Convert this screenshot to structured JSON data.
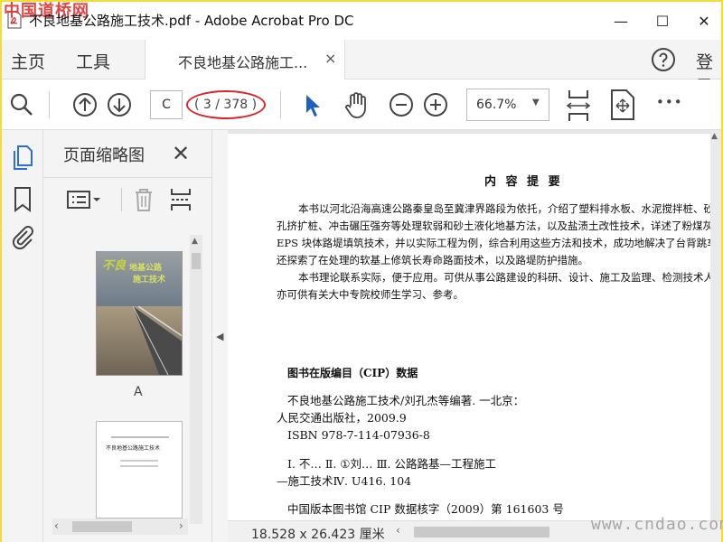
{
  "window": {
    "title": "不良地基公路施工技术.pdf - Adobe Acrobat Pro DC",
    "watermark_top": "中国道桥网",
    "minimize": "—",
    "maximize": "☐",
    "close": "✕"
  },
  "tabs": {
    "home": "主页",
    "tools": "工具",
    "document": "不良地基公路施工...",
    "close": "×",
    "login": "登录"
  },
  "toolbar": {
    "page_current": "C",
    "page_count": "( 3 / 378 )",
    "zoom": "66.7%",
    "zoom_arrow": "▼",
    "more": "•••"
  },
  "thumbnails": {
    "title": "页面缩略图",
    "close": "✕",
    "items": [
      {
        "label": "A",
        "cover_title_1": "不良",
        "cover_title_2": "地基公路",
        "cover_title_3": "施工技术"
      },
      {
        "label": "",
        "cover_text": "不良地基公路施工技术"
      }
    ]
  },
  "document": {
    "heading": "内 容 提 要",
    "summary_lines": [
      "本书以河北沿海高速公路秦皇岛至冀津界路段为依托，介绍了塑料排水板、水泥搅拌桩、砂",
      "孔挤扩桩、冲击碾压强夯等处理软弱和砂土液化地基方法，以及盐渍土改性技术，详述了粉煤灰、",
      "EPS 块体路堤填筑技术，并以实际工程为例，综合利用这些方法和技术，成功地解决了台背跳车，",
      "还探索了在处理的软基上修筑长寿命路面技术，以及路堤防护措施。",
      "本书理论联系实际，便于应用。可供从事公路建设的科研、设计、施工及监理、检测技术人员",
      "亦可供有关大中专院校师生学习、参考。"
    ],
    "cip_heading": "图书在版编目（CIP）数据",
    "cip_lines": [
      "不良地基公路施工技术/刘孔杰等编著. 一北京：",
      "人民交通出版社，2009.9",
      "ISBN  978-7-114-07936-8",
      "Ⅰ. 不…   Ⅱ. ①刘…   Ⅲ. 公路路基—工程施工",
      "—施工技术Ⅳ. U416. 104",
      "中国版本图书馆 CIP 数据核字（2009）第 161603 号"
    ],
    "page_size": "18.528 x 26.423 厘米",
    "watermark": "www.cndao.com"
  },
  "colors": {
    "accent_blue": "#2c6fd4",
    "oval_red": "#d8262c",
    "pointer_blue": "#1e5fbf"
  }
}
